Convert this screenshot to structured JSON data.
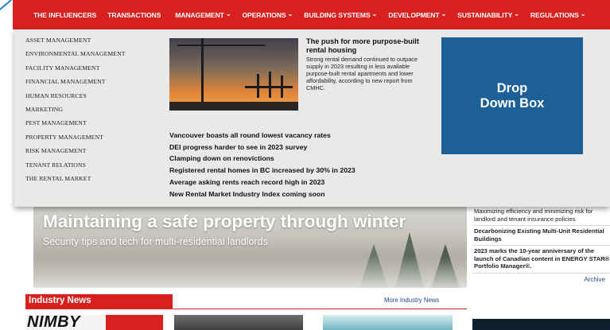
{
  "nav": {
    "items": [
      {
        "label": "THE INFLUENCERS",
        "has_dropdown": false
      },
      {
        "label": "TRANSACTIONS",
        "has_dropdown": false
      },
      {
        "label": "MANAGEMENT",
        "has_dropdown": true
      },
      {
        "label": "OPERATIONS",
        "has_dropdown": true
      },
      {
        "label": "BUILDING SYSTEMS",
        "has_dropdown": true
      },
      {
        "label": "DEVELOPMENT",
        "has_dropdown": true
      },
      {
        "label": "SUSTAINABILITY",
        "has_dropdown": true
      },
      {
        "label": "REGULATIONS",
        "has_dropdown": true
      }
    ],
    "chevron_icon": "chevron-down-icon",
    "bg_color": "#d8201e"
  },
  "dropdown": {
    "categories": [
      "ASSET MANAGEMENT",
      "ENVIRONMENTAL MANAGEMENT",
      "FACILITY MANAGEMENT",
      "FINANCIAL MANAGEMENT",
      "HUMAN RESOURCES",
      "MARKETING",
      "PEST MANAGEMENT",
      "PROPERTY MANAGEMENT",
      "RISK MANAGEMENT",
      "TENANT RELATIONS",
      "THE RENTAL MARKET"
    ],
    "featured": {
      "title": "The push for more purpose-built rental housing",
      "body": "Strong rental demand continued to outpace supply in 2023 resulting in less available purpose-built rental apartments and lower affordability, according to new report from CMHC."
    },
    "links": [
      "Vancouver boasts all round lowest vacancy rates",
      "DEI progress harder to see in 2023 survey",
      "Clamping down on renovictions",
      "Registered rental homes in BC increased by 30% in 2023",
      "Average asking rents reach record high in 2023",
      "New Rental Market Industry Index coming soon"
    ],
    "drop_box_label": "Drop\nDown Box",
    "drop_box_color": "#1d5f97",
    "bg_color": "#e9e9e9"
  },
  "hero": {
    "title": "Maintaining a safe property through winter",
    "subtitle": "Security tips and tech for multi-residential landlords"
  },
  "sidebar": {
    "items": [
      {
        "text": "Maximizing efficiency and minimizing risk for landlord and tenant insurance policies",
        "bold": false
      },
      {
        "text": "Decarbonizing Existing Multi-Unit Residential Buildings",
        "bold": true
      },
      {
        "text": "2023 marks the 10-year anniversary of the launch of Canadian content in ENERGY STAR® Portfolio Manager®.",
        "bold": true
      }
    ],
    "archive_label": "Archive"
  },
  "industry_news": {
    "heading": "Industry News",
    "more_label": "More Industry News",
    "thumb1_text": "NIMBY"
  }
}
